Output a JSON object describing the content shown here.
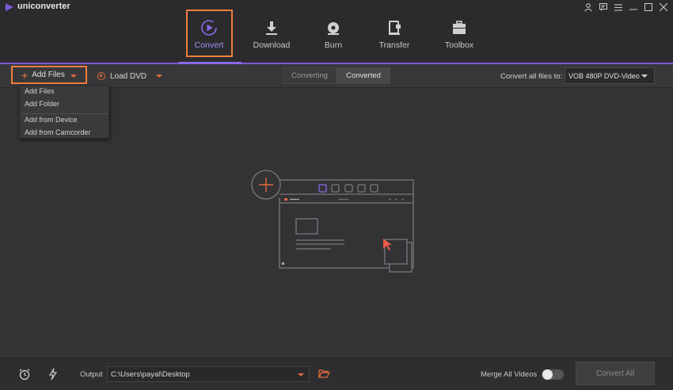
{
  "app": {
    "title": "uniconverter"
  },
  "window_controls": [
    "user-icon",
    "gift-icon",
    "menu-icon",
    "minimize-icon",
    "maximize-icon",
    "close-icon"
  ],
  "nav": {
    "items": [
      {
        "label": "Convert",
        "icon": "convert-icon",
        "active": true
      },
      {
        "label": "Download",
        "icon": "download-icon",
        "active": false
      },
      {
        "label": "Burn",
        "icon": "burn-icon",
        "active": false
      },
      {
        "label": "Transfer",
        "icon": "transfer-icon",
        "active": false
      },
      {
        "label": "Toolbox",
        "icon": "toolbox-icon",
        "active": false
      }
    ]
  },
  "toolbar": {
    "add_files": "Add Files",
    "load_dvd": "Load DVD",
    "tabs": {
      "converting": "Converting",
      "converted": "Converted"
    },
    "convert_all_label": "Convert all files to:",
    "format": "VOB 480P DVD-Video"
  },
  "dropdown": {
    "items": [
      "Add Files",
      "Add Folder",
      "Add from Device",
      "Add from Camcorder"
    ]
  },
  "bottom": {
    "output_label": "Output",
    "output_path": "C:\\Users\\payal\\Desktop",
    "merge_label": "Merge All Videos",
    "merge_enabled": false,
    "convert_all": "Convert All"
  },
  "colors": {
    "accent_purple": "#8a68e8",
    "highlight_orange": "#f07d3c",
    "background": "#333336"
  }
}
